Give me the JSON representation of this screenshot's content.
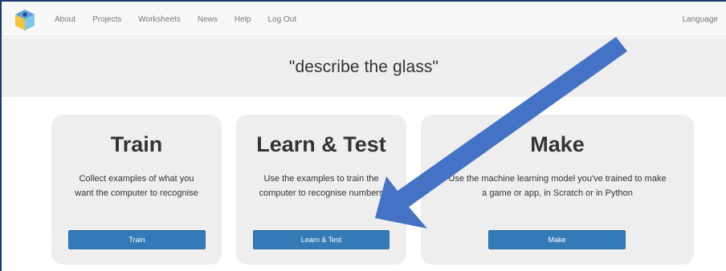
{
  "nav": {
    "links": [
      "About",
      "Projects",
      "Worksheets",
      "News",
      "Help",
      "Log Out"
    ],
    "language": "Language"
  },
  "project": {
    "title": "\"describe the glass\""
  },
  "cards": [
    {
      "heading": "Train",
      "description_lines": [
        "Collect examples of what you",
        "want the computer to recognise"
      ],
      "button": "Train"
    },
    {
      "heading": "Learn & Test",
      "description_lines": [
        "Use the examples to train the",
        "computer to recognise numbers"
      ],
      "button": "Learn & Test"
    },
    {
      "heading": "Make",
      "description_lines": [
        "Use the machine learning model you've trained to make",
        "a game or app, in Scratch or in Python"
      ],
      "button": "Make"
    }
  ],
  "colors": {
    "button": "#337ab7",
    "card_bg": "#eeeeee",
    "arrow": "#4472c4"
  },
  "icons": {
    "logo": "machine-learning-cube-logo-icon",
    "annotation": "pointer-arrow"
  }
}
